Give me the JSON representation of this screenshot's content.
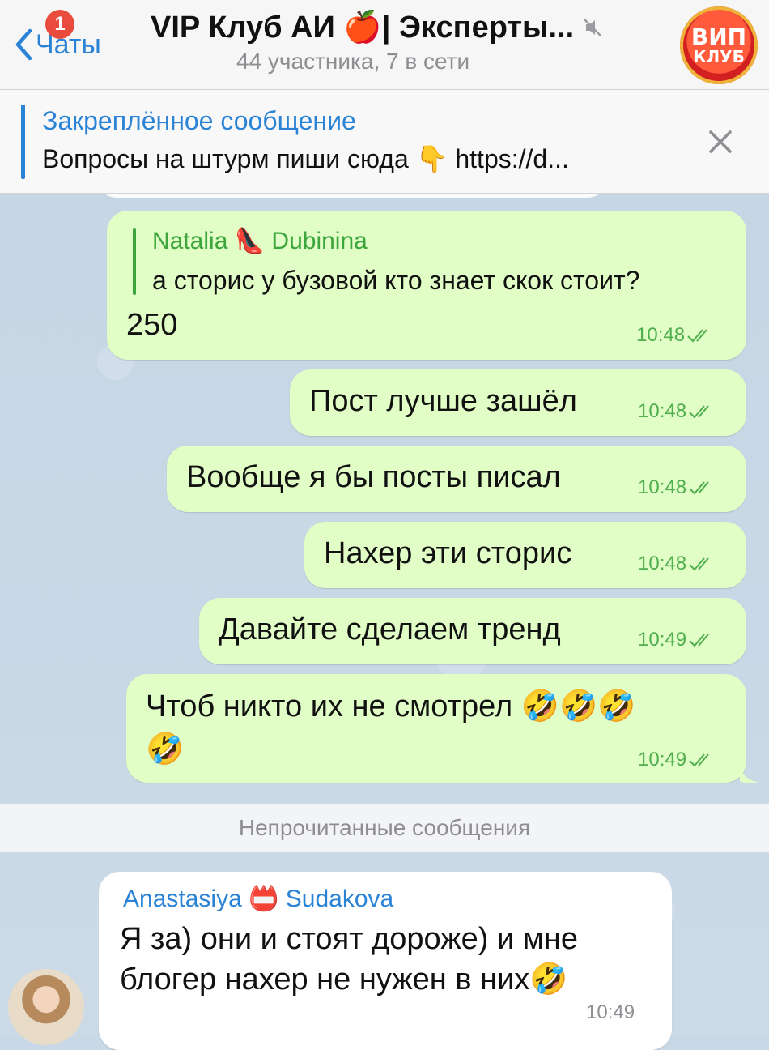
{
  "header": {
    "back_label": "Чаты",
    "unread_badge": "1",
    "title": "VIP Клуб АИ 🍎| Эксперты...",
    "subtitle": "44 участника, 7 в сети",
    "logo_line1": "ВИП",
    "logo_line2": "КЛУБ",
    "accent_color": "#2b83d6"
  },
  "pinned": {
    "title": "Закреплённое сообщение",
    "text": "Вопросы на штурм пиши сюда 👇 https://d..."
  },
  "messages_out": [
    {
      "reply_name": "Natalia 👠 Dubinina",
      "reply_text": "а сторис у бузовой кто знает скок стоит?",
      "text": "250",
      "time": "10:48"
    },
    {
      "text": "Пост лучше зашёл",
      "time": "10:48"
    },
    {
      "text": "Вообще я бы посты писал",
      "time": "10:48"
    },
    {
      "text": "Нахер эти сторис",
      "time": "10:48"
    },
    {
      "text": "Давайте сделаем тренд",
      "time": "10:49"
    },
    {
      "text": "Чтоб никто их не смотрел 🤣🤣🤣",
      "text2": "🤣",
      "time": "10:49"
    }
  ],
  "unread_divider": "Непрочитанные сообщения",
  "message_in": {
    "sender": "Anastasiya 📛 Sudakova",
    "line1": "Я за) они и стоят дороже) и мне",
    "line2": "блогер нахер не нужен в них🤣",
    "time": "10:49"
  }
}
